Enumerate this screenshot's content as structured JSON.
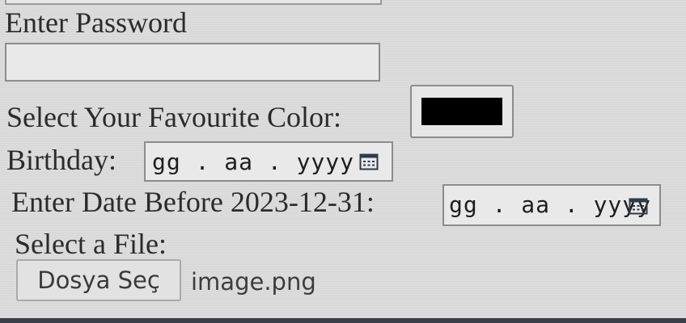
{
  "form": {
    "password": {
      "label": "Enter Password",
      "value": ""
    },
    "favourite_color": {
      "label": "Select Your Favourite Color:",
      "value": "#000000"
    },
    "birthday": {
      "label": "Birthday:",
      "placeholder": "gg . aa . yyyy",
      "icon": "calendar-icon"
    },
    "date_before": {
      "label": "Enter Date Before 2023-12-31:",
      "placeholder": "gg . aa . yyyy",
      "icon": "calendar-icon"
    },
    "file": {
      "label": "Select a File:",
      "button_label": "Dosya Seç",
      "selected_file": "image.png"
    }
  }
}
